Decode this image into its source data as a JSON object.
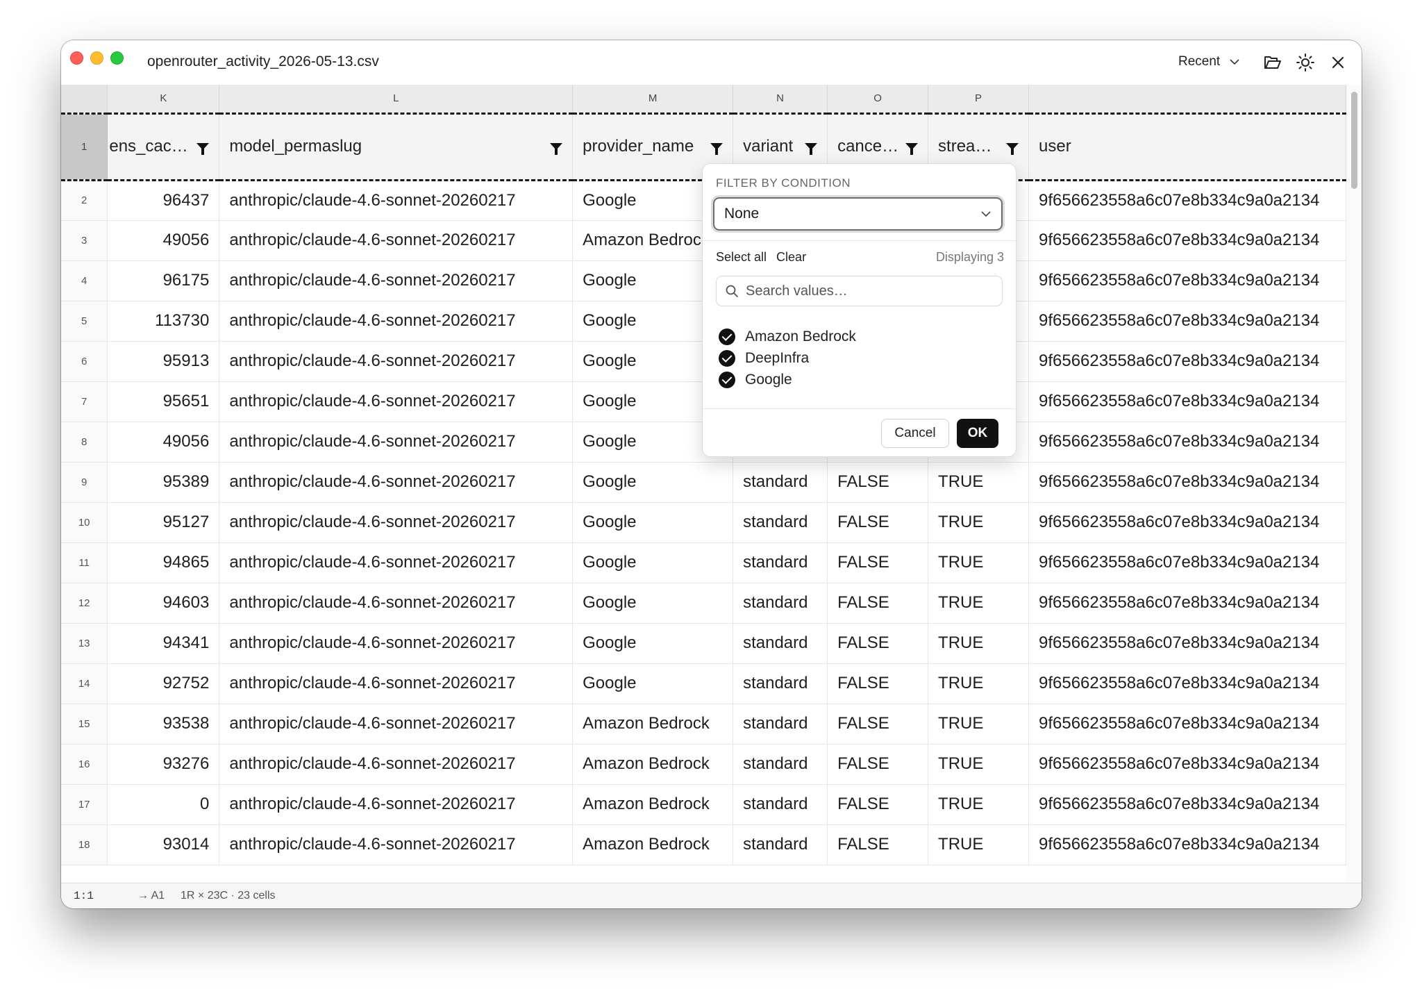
{
  "window": {
    "title": "openrouter_activity_2026-05-13.csv",
    "recent_label": "Recent"
  },
  "grid": {
    "column_letters": [
      "K",
      "L",
      "M",
      "N",
      "O",
      "P",
      ""
    ],
    "header_row_number": "1",
    "headers": [
      "ens_cac…",
      "model_permaslug",
      "provider_name",
      "variant",
      "cance…",
      "strea…",
      "user"
    ],
    "rows": [
      {
        "n": "2",
        "k": "96437",
        "model": "anthropic/claude-4.6-sonnet-20260217",
        "provider": "Google",
        "variant": "",
        "cancelled": "",
        "streamed": "",
        "user": "9f656623558a6c07e8b334c9a0a2134"
      },
      {
        "n": "3",
        "k": "49056",
        "model": "anthropic/claude-4.6-sonnet-20260217",
        "provider": "Amazon Bedroc",
        "variant": "",
        "cancelled": "",
        "streamed": "",
        "user": "9f656623558a6c07e8b334c9a0a2134"
      },
      {
        "n": "4",
        "k": "96175",
        "model": "anthropic/claude-4.6-sonnet-20260217",
        "provider": "Google",
        "variant": "",
        "cancelled": "",
        "streamed": "",
        "user": "9f656623558a6c07e8b334c9a0a2134"
      },
      {
        "n": "5",
        "k": "113730",
        "model": "anthropic/claude-4.6-sonnet-20260217",
        "provider": "Google",
        "variant": "",
        "cancelled": "",
        "streamed": "",
        "user": "9f656623558a6c07e8b334c9a0a2134"
      },
      {
        "n": "6",
        "k": "95913",
        "model": "anthropic/claude-4.6-sonnet-20260217",
        "provider": "Google",
        "variant": "",
        "cancelled": "",
        "streamed": "",
        "user": "9f656623558a6c07e8b334c9a0a2134"
      },
      {
        "n": "7",
        "k": "95651",
        "model": "anthropic/claude-4.6-sonnet-20260217",
        "provider": "Google",
        "variant": "",
        "cancelled": "",
        "streamed": "",
        "user": "9f656623558a6c07e8b334c9a0a2134"
      },
      {
        "n": "8",
        "k": "49056",
        "model": "anthropic/claude-4.6-sonnet-20260217",
        "provider": "Google",
        "variant": "",
        "cancelled": "",
        "streamed": "",
        "user": "9f656623558a6c07e8b334c9a0a2134"
      },
      {
        "n": "9",
        "k": "95389",
        "model": "anthropic/claude-4.6-sonnet-20260217",
        "provider": "Google",
        "variant": "standard",
        "cancelled": "FALSE",
        "streamed": "TRUE",
        "user": "9f656623558a6c07e8b334c9a0a2134"
      },
      {
        "n": "10",
        "k": "95127",
        "model": "anthropic/claude-4.6-sonnet-20260217",
        "provider": "Google",
        "variant": "standard",
        "cancelled": "FALSE",
        "streamed": "TRUE",
        "user": "9f656623558a6c07e8b334c9a0a2134"
      },
      {
        "n": "11",
        "k": "94865",
        "model": "anthropic/claude-4.6-sonnet-20260217",
        "provider": "Google",
        "variant": "standard",
        "cancelled": "FALSE",
        "streamed": "TRUE",
        "user": "9f656623558a6c07e8b334c9a0a2134"
      },
      {
        "n": "12",
        "k": "94603",
        "model": "anthropic/claude-4.6-sonnet-20260217",
        "provider": "Google",
        "variant": "standard",
        "cancelled": "FALSE",
        "streamed": "TRUE",
        "user": "9f656623558a6c07e8b334c9a0a2134"
      },
      {
        "n": "13",
        "k": "94341",
        "model": "anthropic/claude-4.6-sonnet-20260217",
        "provider": "Google",
        "variant": "standard",
        "cancelled": "FALSE",
        "streamed": "TRUE",
        "user": "9f656623558a6c07e8b334c9a0a2134"
      },
      {
        "n": "14",
        "k": "92752",
        "model": "anthropic/claude-4.6-sonnet-20260217",
        "provider": "Google",
        "variant": "standard",
        "cancelled": "FALSE",
        "streamed": "TRUE",
        "user": "9f656623558a6c07e8b334c9a0a2134"
      },
      {
        "n": "15",
        "k": "93538",
        "model": "anthropic/claude-4.6-sonnet-20260217",
        "provider": "Amazon Bedrock",
        "variant": "standard",
        "cancelled": "FALSE",
        "streamed": "TRUE",
        "user": "9f656623558a6c07e8b334c9a0a2134"
      },
      {
        "n": "16",
        "k": "93276",
        "model": "anthropic/claude-4.6-sonnet-20260217",
        "provider": "Amazon Bedrock",
        "variant": "standard",
        "cancelled": "FALSE",
        "streamed": "TRUE",
        "user": "9f656623558a6c07e8b334c9a0a2134"
      },
      {
        "n": "17",
        "k": "0",
        "model": "anthropic/claude-4.6-sonnet-20260217",
        "provider": "Amazon Bedrock",
        "variant": "standard",
        "cancelled": "FALSE",
        "streamed": "TRUE",
        "user": "9f656623558a6c07e8b334c9a0a2134"
      },
      {
        "n": "18",
        "k": "93014",
        "model": "anthropic/claude-4.6-sonnet-20260217",
        "provider": "Amazon Bedrock",
        "variant": "standard",
        "cancelled": "FALSE",
        "streamed": "TRUE",
        "user": "9f656623558a6c07e8b334c9a0a2134"
      }
    ]
  },
  "filter_popover": {
    "title": "FILTER BY CONDITION",
    "condition_value": "None",
    "select_all_label": "Select all",
    "clear_label": "Clear",
    "displaying_label": "Displaying 3",
    "search_placeholder": "Search values…",
    "options": [
      {
        "label": "Amazon Bedrock",
        "checked": true
      },
      {
        "label": "DeepInfra",
        "checked": true
      },
      {
        "label": "Google",
        "checked": true
      }
    ],
    "cancel_label": "Cancel",
    "ok_label": "OK"
  },
  "statusbar": {
    "position": "1:1",
    "cell_ref": "→ A1",
    "selection": "1R × 23C · 23 cells"
  },
  "icons": [
    "chevron-down-icon",
    "folder-open-icon",
    "sun-icon",
    "close-icon",
    "filter-icon",
    "search-icon",
    "check-icon"
  ]
}
